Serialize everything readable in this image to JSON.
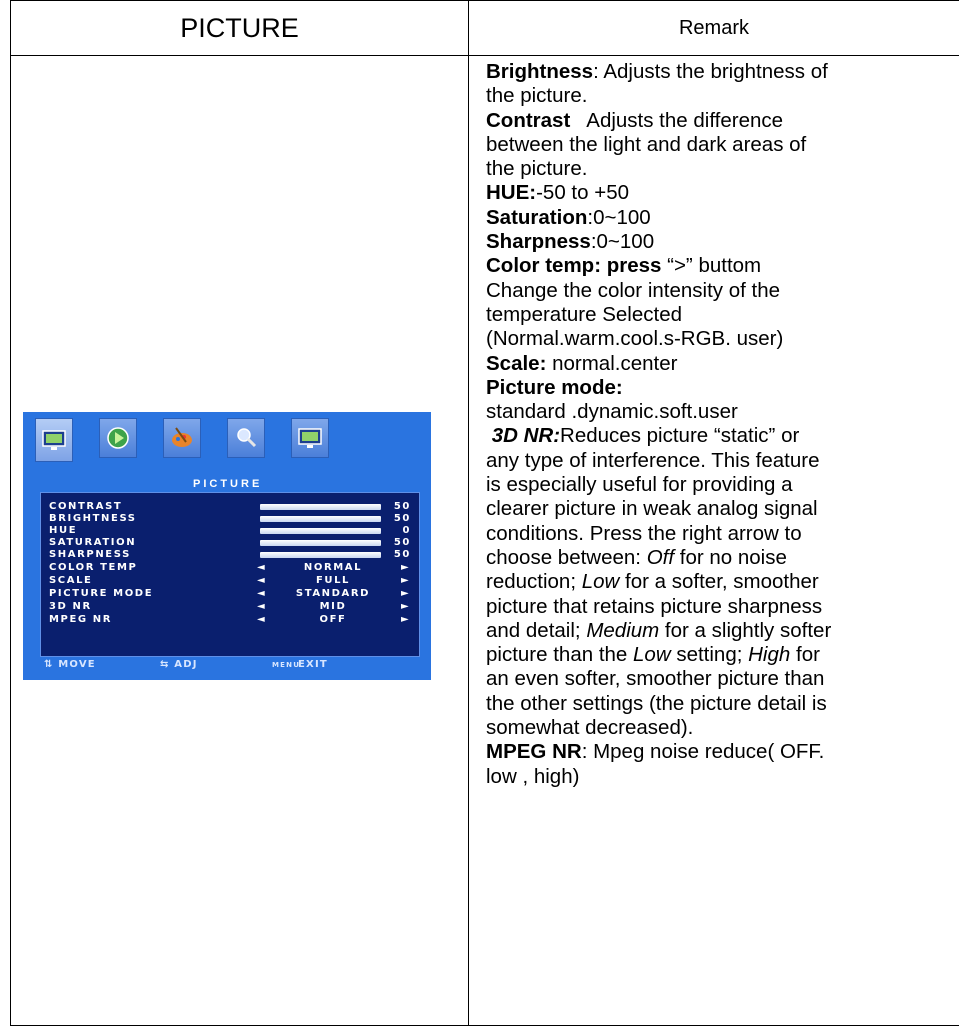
{
  "table": {
    "header_left": "PICTURE",
    "header_right": "Remark"
  },
  "osd": {
    "icons": [
      "picture-icon",
      "play-icon",
      "paint-palette-icon",
      "magnifier-icon",
      "monitor-icon"
    ],
    "title": "PICTURE",
    "rows": [
      {
        "label": "CONTRAST",
        "value": "50"
      },
      {
        "label": "BRIGHTNESS",
        "value": "50"
      },
      {
        "label": "HUE",
        "value": "0"
      },
      {
        "label": "SATURATION",
        "value": "50"
      },
      {
        "label": "SHARPNESS",
        "value": "50"
      },
      {
        "label": "COLOR TEMP",
        "option": "NORMAL"
      },
      {
        "label": "SCALE",
        "option": "FULL"
      },
      {
        "label": "PICTURE MODE",
        "option": "STANDARD"
      },
      {
        "label": "3D NR",
        "option": "MID"
      },
      {
        "label": "MPEG NR",
        "option": "OFF"
      }
    ],
    "footer": {
      "move": "⇅ MOVE",
      "adj": "⇆ ADJ",
      "menu_key": "MENU",
      "exit": "EXIT"
    },
    "colors": {
      "background": "#2a74e0",
      "panel": "#0a1f6e",
      "text": "#ffffff"
    }
  },
  "remark": {
    "brightness_term": "Brightness",
    "brightness_text_1": ": Adjusts the brightness of",
    "brightness_text_2": "the picture.",
    "contrast_term": "Contrast",
    "contrast_text_1": "Adjusts the difference",
    "contrast_text_2": "between the light and dark areas of",
    "contrast_text_3": "the picture.",
    "hue_term": "HUE:",
    "hue_text": "-50 to +50",
    "saturation_term": "Saturation",
    "saturation_text": ":0~100",
    "sharpness_term": "Sharpness",
    "sharpness_text": ":0~100",
    "colortemp_term": "Color temp: press",
    "colortemp_key": "“>”",
    "colortemp_text": " buttom",
    "colortemp_line_2": "Change the color intensity of the",
    "colortemp_line_3": "temperature Selected",
    "colortemp_line_4": "(Normal.warm.cool.s-RGB. user)",
    "scale_term": "Scale:",
    "scale_text": " normal.center",
    "picturemode_term": "Picture mode:",
    "picturemode_text": "standard .dynamic.soft.user",
    "nr3d_term": "3D NR:",
    "nr3d_line_1": "Reduces  picture “static” or",
    "nr3d_line_2": "any type of interference. This feature",
    "nr3d_line_3": "is especially useful for providing a",
    "nr3d_line_4": "clearer picture in weak analog signal",
    "nr3d_line_5": "conditions. Press the right arrow to",
    "nr3d_line_6a": "choose between: ",
    "nr3d_off": "Off",
    "nr3d_line_6b": " for no noise",
    "nr3d_line_7a": "reduction; ",
    "nr3d_low": "Low",
    "nr3d_line_7b": " for a softer, smoother",
    "nr3d_line_8": "picture that retains picture sharpness",
    "nr3d_line_9a": "and detail; ",
    "nr3d_medium": "Medium",
    "nr3d_line_9b": " for a slightly softer",
    "nr3d_line_10a": "picture than the ",
    "nr3d_low2": "Low",
    "nr3d_line_10b": " setting; ",
    "nr3d_high": "High",
    "nr3d_line_10c": " for",
    "nr3d_line_11": "an even softer, smoother picture than",
    "nr3d_line_12": "the other settings (the picture detail is",
    "nr3d_line_13": "somewhat decreased).",
    "mpeg_term": "MPEG NR",
    "mpeg_text": ": Mpeg noise reduce( OFF.",
    "mpeg_line_2": "low , high)"
  }
}
